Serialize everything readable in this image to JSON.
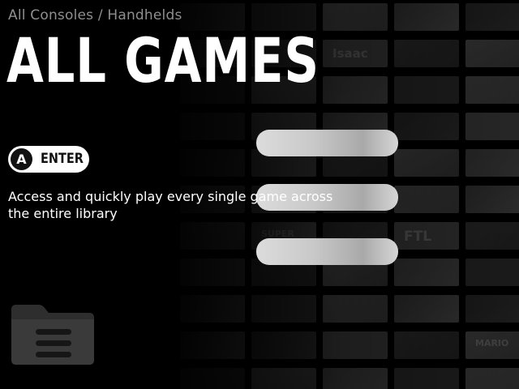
{
  "breadcrumb": "All Consoles / Handhelds",
  "title": "ALL GAMES",
  "action": {
    "button_glyph": "A",
    "label": "ENTER"
  },
  "description": "Access and quickly play every single game across the entire library",
  "menu_slots": [
    {
      "label": ""
    },
    {
      "label": ""
    },
    {
      "label": ""
    }
  ],
  "background_tiles": [
    "Isaac",
    "FTL",
    "SUPER",
    "MARIO"
  ],
  "icons": {
    "section_icon": "folder-list-icon",
    "button_icon": "a-button-icon"
  },
  "colors": {
    "background": "#000000",
    "title": "#ffffff",
    "breadcrumb": "#8f8f8f",
    "pill": "#ffffff",
    "slot": "#c9c9c9"
  }
}
